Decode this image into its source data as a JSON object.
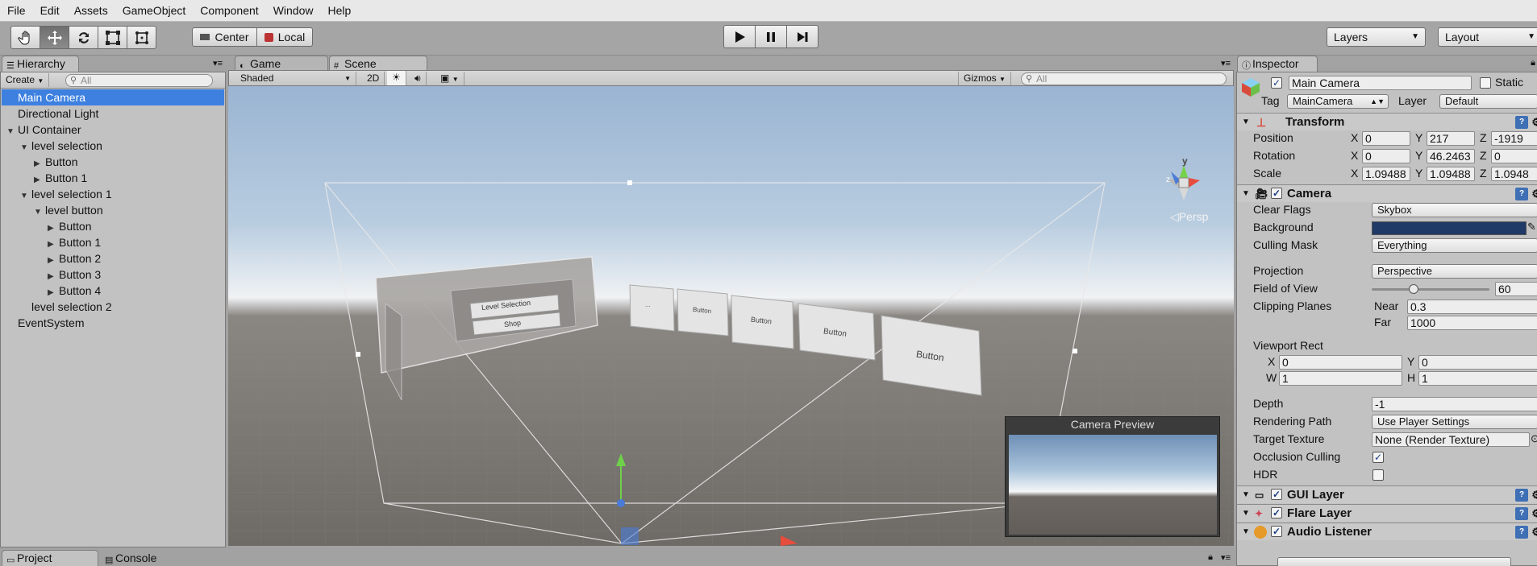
{
  "menu": [
    "File",
    "Edit",
    "Assets",
    "GameObject",
    "Component",
    "Window",
    "Help"
  ],
  "toolbar": {
    "pivot": "Center",
    "space": "Local",
    "layers": "Layers",
    "layout": "Layout"
  },
  "hierarchy": {
    "tab": "Hierarchy",
    "create": "Create",
    "search_placeholder": "All",
    "items": [
      {
        "label": "Main Camera",
        "indent": 0,
        "tri": "",
        "selected": true
      },
      {
        "label": "Directional Light",
        "indent": 0,
        "tri": ""
      },
      {
        "label": "UI Container",
        "indent": 0,
        "tri": "▼"
      },
      {
        "label": "level selection",
        "indent": 1,
        "tri": "▼"
      },
      {
        "label": "Button",
        "indent": 2,
        "tri": "▶"
      },
      {
        "label": "Button 1",
        "indent": 2,
        "tri": "▶"
      },
      {
        "label": "level selection 1",
        "indent": 1,
        "tri": "▼"
      },
      {
        "label": "level button",
        "indent": 2,
        "tri": "▼"
      },
      {
        "label": "Button",
        "indent": 3,
        "tri": "▶"
      },
      {
        "label": "Button 1",
        "indent": 3,
        "tri": "▶"
      },
      {
        "label": "Button 2",
        "indent": 3,
        "tri": "▶"
      },
      {
        "label": "Button 3",
        "indent": 3,
        "tri": "▶"
      },
      {
        "label": "Button 4",
        "indent": 3,
        "tri": "▶"
      },
      {
        "label": "level selection 2",
        "indent": 1,
        "tri": ""
      },
      {
        "label": "EventSystem",
        "indent": 0,
        "tri": ""
      }
    ]
  },
  "scene": {
    "tabs": [
      "Game",
      "Scene"
    ],
    "shading": "Shaded",
    "mode_2d": "2D",
    "gizmos": "Gizmos",
    "search_placeholder": "All",
    "persp": "Persp",
    "gizmo_y": "y",
    "gizmo_z": "z",
    "camera_preview": "Camera Preview",
    "world_buttons": [
      "Level Selection",
      "Shop",
      "...",
      "Button",
      "Button",
      "Button",
      "Button"
    ]
  },
  "inspector": {
    "tab": "Inspector",
    "object_name": "Main Camera",
    "static_label": "Static",
    "tag_label": "Tag",
    "tag_value": "MainCamera",
    "layer_label": "Layer",
    "layer_value": "Default",
    "transform": {
      "title": "Transform",
      "position_label": "Position",
      "position": [
        "0",
        "217",
        "-1919"
      ],
      "rotation_label": "Rotation",
      "rotation": [
        "0",
        "46.2463",
        "0"
      ],
      "scale_label": "Scale",
      "scale": [
        "1.09488",
        "1.09488",
        "1.0948"
      ]
    },
    "camera": {
      "title": "Camera",
      "clear_flags_label": "Clear Flags",
      "clear_flags": "Skybox",
      "background_label": "Background",
      "culling_mask_label": "Culling Mask",
      "culling_mask": "Everything",
      "projection_label": "Projection",
      "projection": "Perspective",
      "fov_label": "Field of View",
      "fov": "60",
      "fov_fraction": 0.33,
      "clipping_label": "Clipping Planes",
      "near_label": "Near",
      "near": "0.3",
      "far_label": "Far",
      "far": "1000",
      "viewport_label": "Viewport Rect",
      "vx": "0",
      "vy": "0",
      "vw": "1",
      "vh": "1",
      "depth_label": "Depth",
      "depth": "-1",
      "rendering_path_label": "Rendering Path",
      "rendering_path": "Use Player Settings",
      "target_texture_label": "Target Texture",
      "target_texture": "None (Render Texture)",
      "occlusion_label": "Occlusion Culling",
      "hdr_label": "HDR"
    },
    "components": [
      "GUI Layer",
      "Flare Layer",
      "Audio Listener"
    ]
  },
  "bottom": {
    "tabs": [
      "Project",
      "Console"
    ]
  },
  "colors": {
    "selection": "#3d80df",
    "background_swatch": "#1f3a66"
  }
}
